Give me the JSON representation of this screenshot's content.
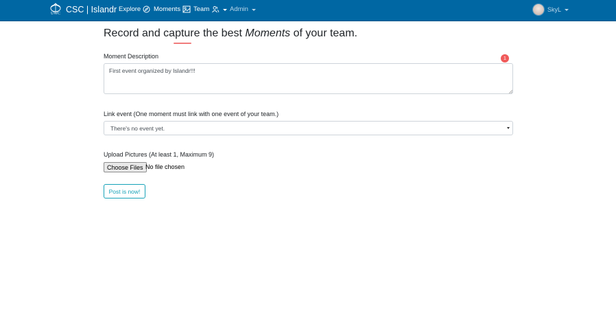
{
  "navbar": {
    "logo_text": "UWC",
    "brand": "CSC | Islandr",
    "items": [
      {
        "label": "Explore",
        "icon": "compass-icon"
      },
      {
        "label": "Moments",
        "icon": "image-icon"
      },
      {
        "label": "Team",
        "icon": "users-icon"
      },
      {
        "label": "Admin"
      }
    ],
    "user": {
      "name": "SkyL"
    }
  },
  "colors": {
    "navbar": "#0067a3",
    "accent": "#17a2b8",
    "underline": "#f07c7c",
    "badge": "#f05a5a"
  },
  "page": {
    "heading_pre": "Record and capture the best ",
    "heading_em": "Moments",
    "heading_post": " of your team."
  },
  "form": {
    "description_label": "Moment Description",
    "description_value": "First event organized by Islandr!!!",
    "badge_count": "1",
    "link_label": "Link event (One moment must link with one event of your team.)",
    "link_selected": "There's no event yet.",
    "upload_label": "Upload Pictures (At least 1, Maximum 9)",
    "choose_files": "Choose Files",
    "file_status": "No file chosen",
    "submit": "Post is now!"
  }
}
